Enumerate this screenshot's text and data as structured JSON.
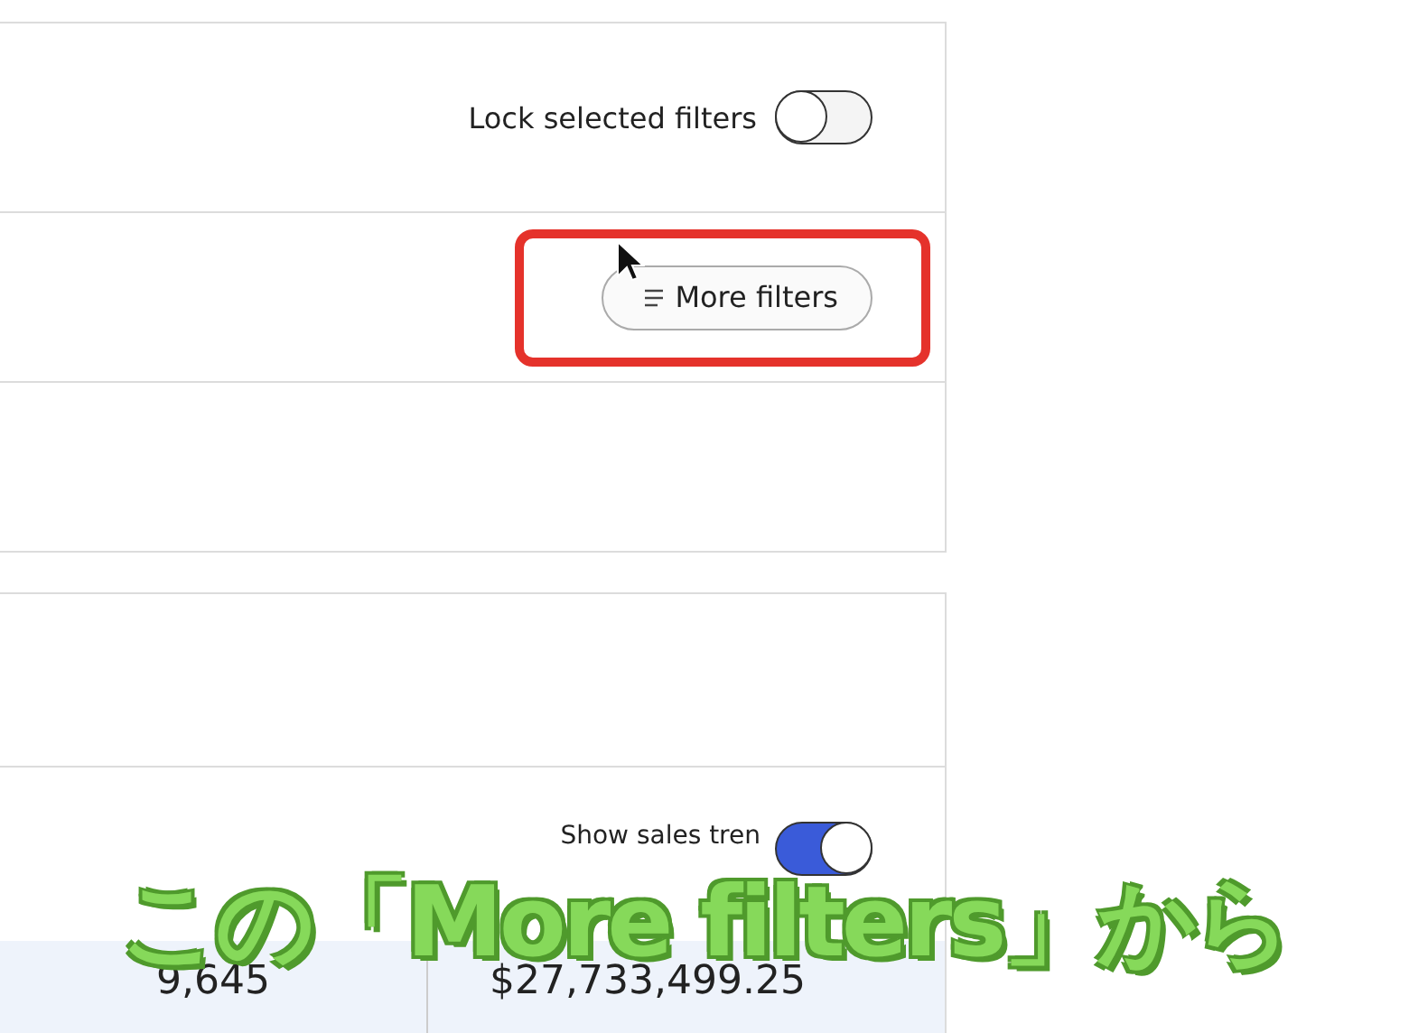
{
  "filters_panel": {
    "lock": {
      "label": "Lock selected filters",
      "on": false
    },
    "more_filters_button": {
      "label": "More filters",
      "highlighted": true
    }
  },
  "sales_panel": {
    "trend_toggle": {
      "label": "Show sales tren",
      "on": true
    },
    "table_row": [
      "9,645",
      "$27,733,499.25"
    ]
  },
  "caption": {
    "text": "この「More filters」から"
  }
}
